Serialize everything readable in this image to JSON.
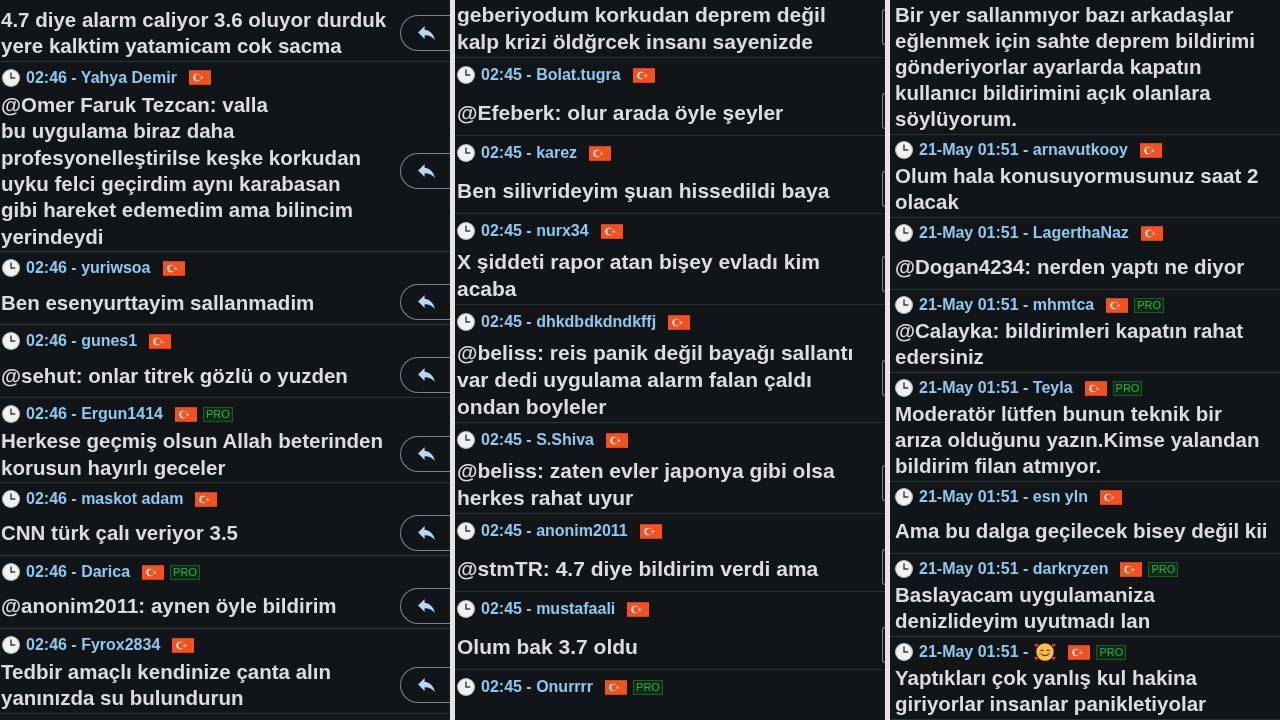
{
  "columns": [
    {
      "kind": "full",
      "messages": [
        {
          "lines": [
            "4.7 diye alarm caliyor 3.6 oluyor durduk",
            "yere kalktim yatamicam cok sacma"
          ]
        },
        {
          "header": "02:46 - Yahya Demir",
          "lines": [
            "@Omer Faruk Tezcan: valla",
            "bu uygulama biraz daha",
            "profesyonelleştirilse keşke korkudan",
            "uyku felci geçirdim aynı karabasan",
            "gibi hareket edemedim ama bilincim",
            "yerindeydi"
          ]
        },
        {
          "header": "02:46 - yuriwsoa",
          "lines": [
            "Ben esenyurttayim sallanmadim"
          ]
        },
        {
          "header": "02:46 - gunes1",
          "lines": [
            "@sehut: onlar titrek gözlü o yuzden"
          ]
        },
        {
          "header": "02:46 - Ergun1414",
          "badge": "PRO",
          "lines": [
            "Herkese geçmiş olsun Allah beterinden",
            "korusun hayırlı geceler"
          ]
        },
        {
          "header": "02:46 - maskot adam",
          "lines": [
            "CNN türk çalı veriyor 3.5"
          ]
        },
        {
          "header": "02:46 - Darica",
          "badge": "PRO",
          "lines": [
            "@anonim2011: aynen öyle bildirim"
          ]
        },
        {
          "header": "02:46 - Fyrox2834",
          "lines": [
            "Tedbir amaçlı kendinize çanta alın",
            "yanınızda su bulundurun"
          ]
        }
      ]
    },
    {
      "kind": "edge",
      "messages": [
        {
          "lines": [
            "geberiyodum korkudan deprem değil",
            "kalp krizi öldğrcek insanı sayenizde"
          ]
        },
        {
          "header": "02:45 - Bolat.tugra",
          "lines": [
            "@Efeberk: olur arada öyle şeyler"
          ]
        },
        {
          "header": "02:45 - karez",
          "lines": [
            "Ben silivrideyim şuan hissedildi baya"
          ]
        },
        {
          "header": "02:45 - nurx34",
          "lines": [
            "X şiddeti rapor atan bişey evladı kim",
            "acaba"
          ]
        },
        {
          "header": "02:45 - dhkdbdkdndkffj",
          "lines": [
            "@beliss: reis panik değil bayağı sallantı",
            "var dedi uygulama alarm falan çaldı",
            "ondan boyleler"
          ]
        },
        {
          "header": "02:45 - S.Shiva",
          "lines": [
            "@beliss: zaten evler japonya gibi olsa",
            "herkes rahat uyur"
          ]
        },
        {
          "header": "02:45 - anonim2011",
          "lines": [
            "@stmTR: 4.7 diye bildirim verdi ama"
          ]
        },
        {
          "header": "02:45 - mustafaali",
          "lines": [
            "Olum bak 3.7 oldu"
          ]
        },
        {
          "header": "02:45 - Onurrrr",
          "badge": "PRO"
        }
      ]
    },
    {
      "kind": "plain",
      "messages": [
        {
          "lines": [
            "Bir yer sallanmıyor bazı arkadaşlar",
            "eğlenmek için sahte deprem bildirimi",
            "gönderiyorlar ayarlarda kapatın",
            "kullanıcı bildirimini açık olanlara",
            "söylüyorum."
          ]
        },
        {
          "header": "21-May 01:51 - arnavutkooy",
          "lines": [
            "Olum hala konusuyormusunuz saat 2",
            "olacak"
          ]
        },
        {
          "header": "21-May 01:51 - LagerthaNaz",
          "lines": [
            "@Dogan4234: nerden yaptı ne diyor"
          ]
        },
        {
          "header": "21-May 01:51 - mhmtca",
          "badge": "PRO",
          "lines": [
            "@Calayka: bildirimleri kapatın rahat",
            "edersiniz"
          ]
        },
        {
          "header": "21-May 01:51 - Teyla",
          "badge": "PRO",
          "lines": [
            "Moderatör lütfen bunun teknik bir",
            "arıza olduğunu yazın.Kimse yalandan",
            "bildirim filan atmıyor."
          ]
        },
        {
          "header": "21-May 01:51 - esn yln",
          "lines": [
            "Ama bu dalga geçilecek bisey değil kii"
          ]
        },
        {
          "header": "21-May 01:51 - darkryzen",
          "badge": "PRO",
          "lines": [
            "Baslayacam uygulamaniza",
            "denizlideyim uyutmadı lan"
          ]
        },
        {
          "header": "21-May 01:51 -",
          "user_emoji": true,
          "badge": "PRO",
          "lines": [
            "Yaptıkları çok yanlış kul hakina",
            "giriyorlar insanlar panikletiyolar"
          ]
        }
      ]
    }
  ]
}
